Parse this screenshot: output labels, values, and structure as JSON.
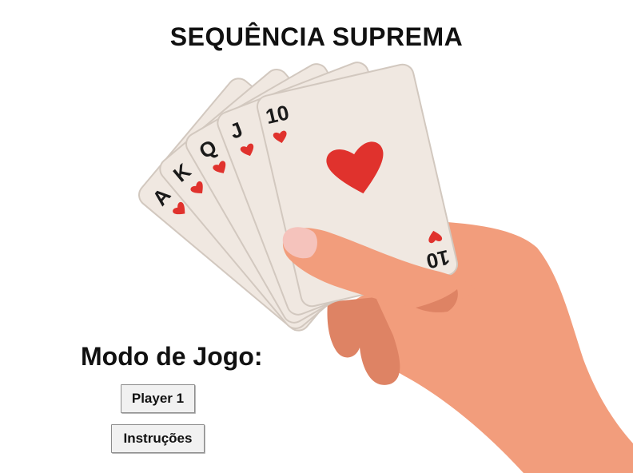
{
  "title": "SEQUÊNCIA SUPREMA",
  "mode": {
    "label": "Modo de Jogo:",
    "buttons": {
      "player1": "Player 1",
      "instructions": "Instruções"
    }
  },
  "cards": [
    {
      "rank": "A",
      "suit": "hearts"
    },
    {
      "rank": "K",
      "suit": "hearts"
    },
    {
      "rank": "Q",
      "suit": "hearts"
    },
    {
      "rank": "J",
      "suit": "hearts"
    },
    {
      "rank": "10",
      "suit": "hearts"
    }
  ],
  "colors": {
    "card_face": "#f0e8e1",
    "card_edge": "#d2c8bf",
    "heart": "#e0322d",
    "skin": "#f29d7c",
    "skin_shadow": "#de8364",
    "nail": "#f5c3bc"
  }
}
